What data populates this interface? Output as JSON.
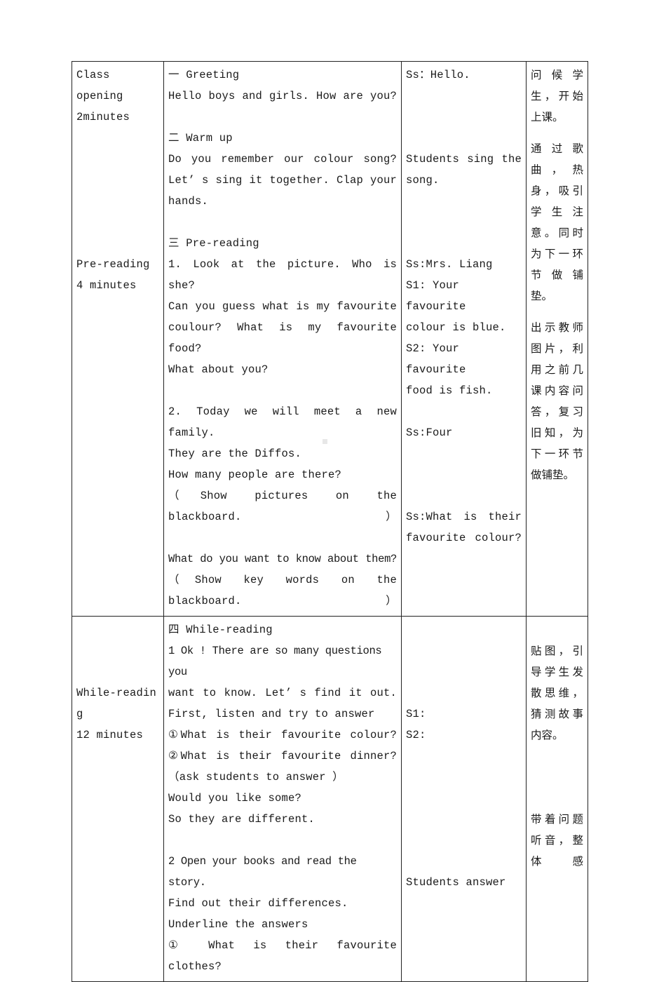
{
  "document": {
    "type": "lesson-plan-table",
    "background_color": "#ffffff",
    "border_color": "#222222"
  },
  "table": {
    "columns": [
      {
        "name": "stage-and-time"
      },
      {
        "name": "teacher-activity"
      },
      {
        "name": "student-response"
      },
      {
        "name": "design-intent-note"
      }
    ],
    "rows": [
      {
        "stage": [
          "Class opening",
          "2minutes",
          "",
          "",
          "",
          "",
          "",
          "",
          "Pre-reading",
          "4 minutes"
        ],
        "activity": [
          "一 Greeting",
          "Hello boys and girls. How are you?",
          "",
          "二 Warm up",
          "Do you remember our colour song?",
          "Let’ s sing it together. Clap your",
          "hands.",
          "",
          "三 Pre-reading",
          "1. Look at the picture. Who is she?",
          "Can you guess what is my favourite",
          "coulour? What is my favourite food?",
          "What about you?",
          "",
          "2. Today we will meet a new family.",
          "They are the Diffos.",
          "How many people are there?",
          "（Show pictures on the blackboard.）",
          "",
          "What do you want to know about them?",
          "（Show key words on the blackboard.）"
        ],
        "response": [
          "Ss：Hello.",
          "",
          "",
          "",
          "Students sing the",
          "song.",
          "",
          "",
          "",
          "Ss:Mrs. Liang",
          "S1: Your favourite",
          "colour is blue.",
          "S2: Your favourite",
          "food is fish.",
          "",
          "Ss:Four",
          "",
          "",
          "",
          "Ss:What is their",
          "favourite colour?"
        ],
        "note_paragraphs": [
          "问候学生，开始上课。",
          "通过歌曲，热身，吸引学生注意。同时为下一环节做铺垫。",
          "出示教师图片，利用之前几课内容问答，复习旧知，为下一环节做铺垫。"
        ]
      },
      {
        "stage": [
          "",
          "",
          "",
          "While-readin",
          "g",
          "12 minutes"
        ],
        "activity": [
          "四 While-reading",
          "1 Ok ! There are so many questions you",
          "want to know. Let’ s find it out.",
          "First, listen and try to answer",
          "①What is their favourite colour?",
          "②What is their favourite dinner?",
          "（ask students to answer ）",
          "Would you like some?",
          "So they are different.",
          "",
          "2 Open your books and read the story.",
          "Find out their differences.",
          "Underline the answers",
          "① What is their favourite clothes?"
        ],
        "response": [
          "",
          "",
          "",
          "",
          "S1:",
          "S2:",
          "",
          "",
          "",
          "",
          "",
          "",
          "Students answer",
          ""
        ],
        "note_paragraphs": [
          "贴图，引导学生发散思维，猜测故事内容。",
          "带着问题听音，整体感"
        ]
      }
    ]
  }
}
